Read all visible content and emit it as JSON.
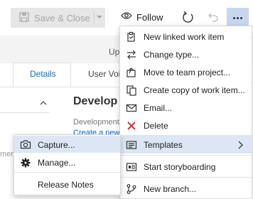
{
  "toolbar": {
    "save_close_label": "Save & Close",
    "follow_label": "Follow",
    "more_label": "…"
  },
  "form": {
    "updated_text": "Up",
    "tabs": [
      {
        "label": "Details"
      },
      {
        "label": "User Voi"
      }
    ],
    "section_title": "Develop",
    "section_subtitle": "Development",
    "create_link": "Create a new",
    "mers_text": "mers"
  },
  "menu": {
    "items": [
      {
        "label": "New linked work item",
        "icon": "new-linked-work-item-icon"
      },
      {
        "label": "Change type...",
        "icon": "change-type-icon"
      },
      {
        "label": "Move to team project...",
        "icon": "move-icon"
      },
      {
        "label": "Create copy of work item...",
        "icon": "copy-icon"
      },
      {
        "label": "Email...",
        "icon": "email-icon"
      },
      {
        "label": "Delete",
        "icon": "delete-icon"
      },
      {
        "label": "Templates",
        "icon": "templates-icon"
      },
      {
        "label": "Start storyboarding",
        "icon": "storyboard-icon"
      },
      {
        "label": "New branch...",
        "icon": "branch-icon"
      }
    ]
  },
  "submenu": {
    "items": [
      {
        "label": "Capture...",
        "icon": "camera-icon"
      },
      {
        "label": "Manage...",
        "icon": "gear-icon"
      },
      {
        "label": "Release Notes",
        "icon": ""
      }
    ]
  },
  "colors": {
    "accent": "#0f6cbd",
    "delete_red": "#d13438",
    "highlight": "#dce6f4",
    "more_button_bg": "#c7d7ee"
  }
}
